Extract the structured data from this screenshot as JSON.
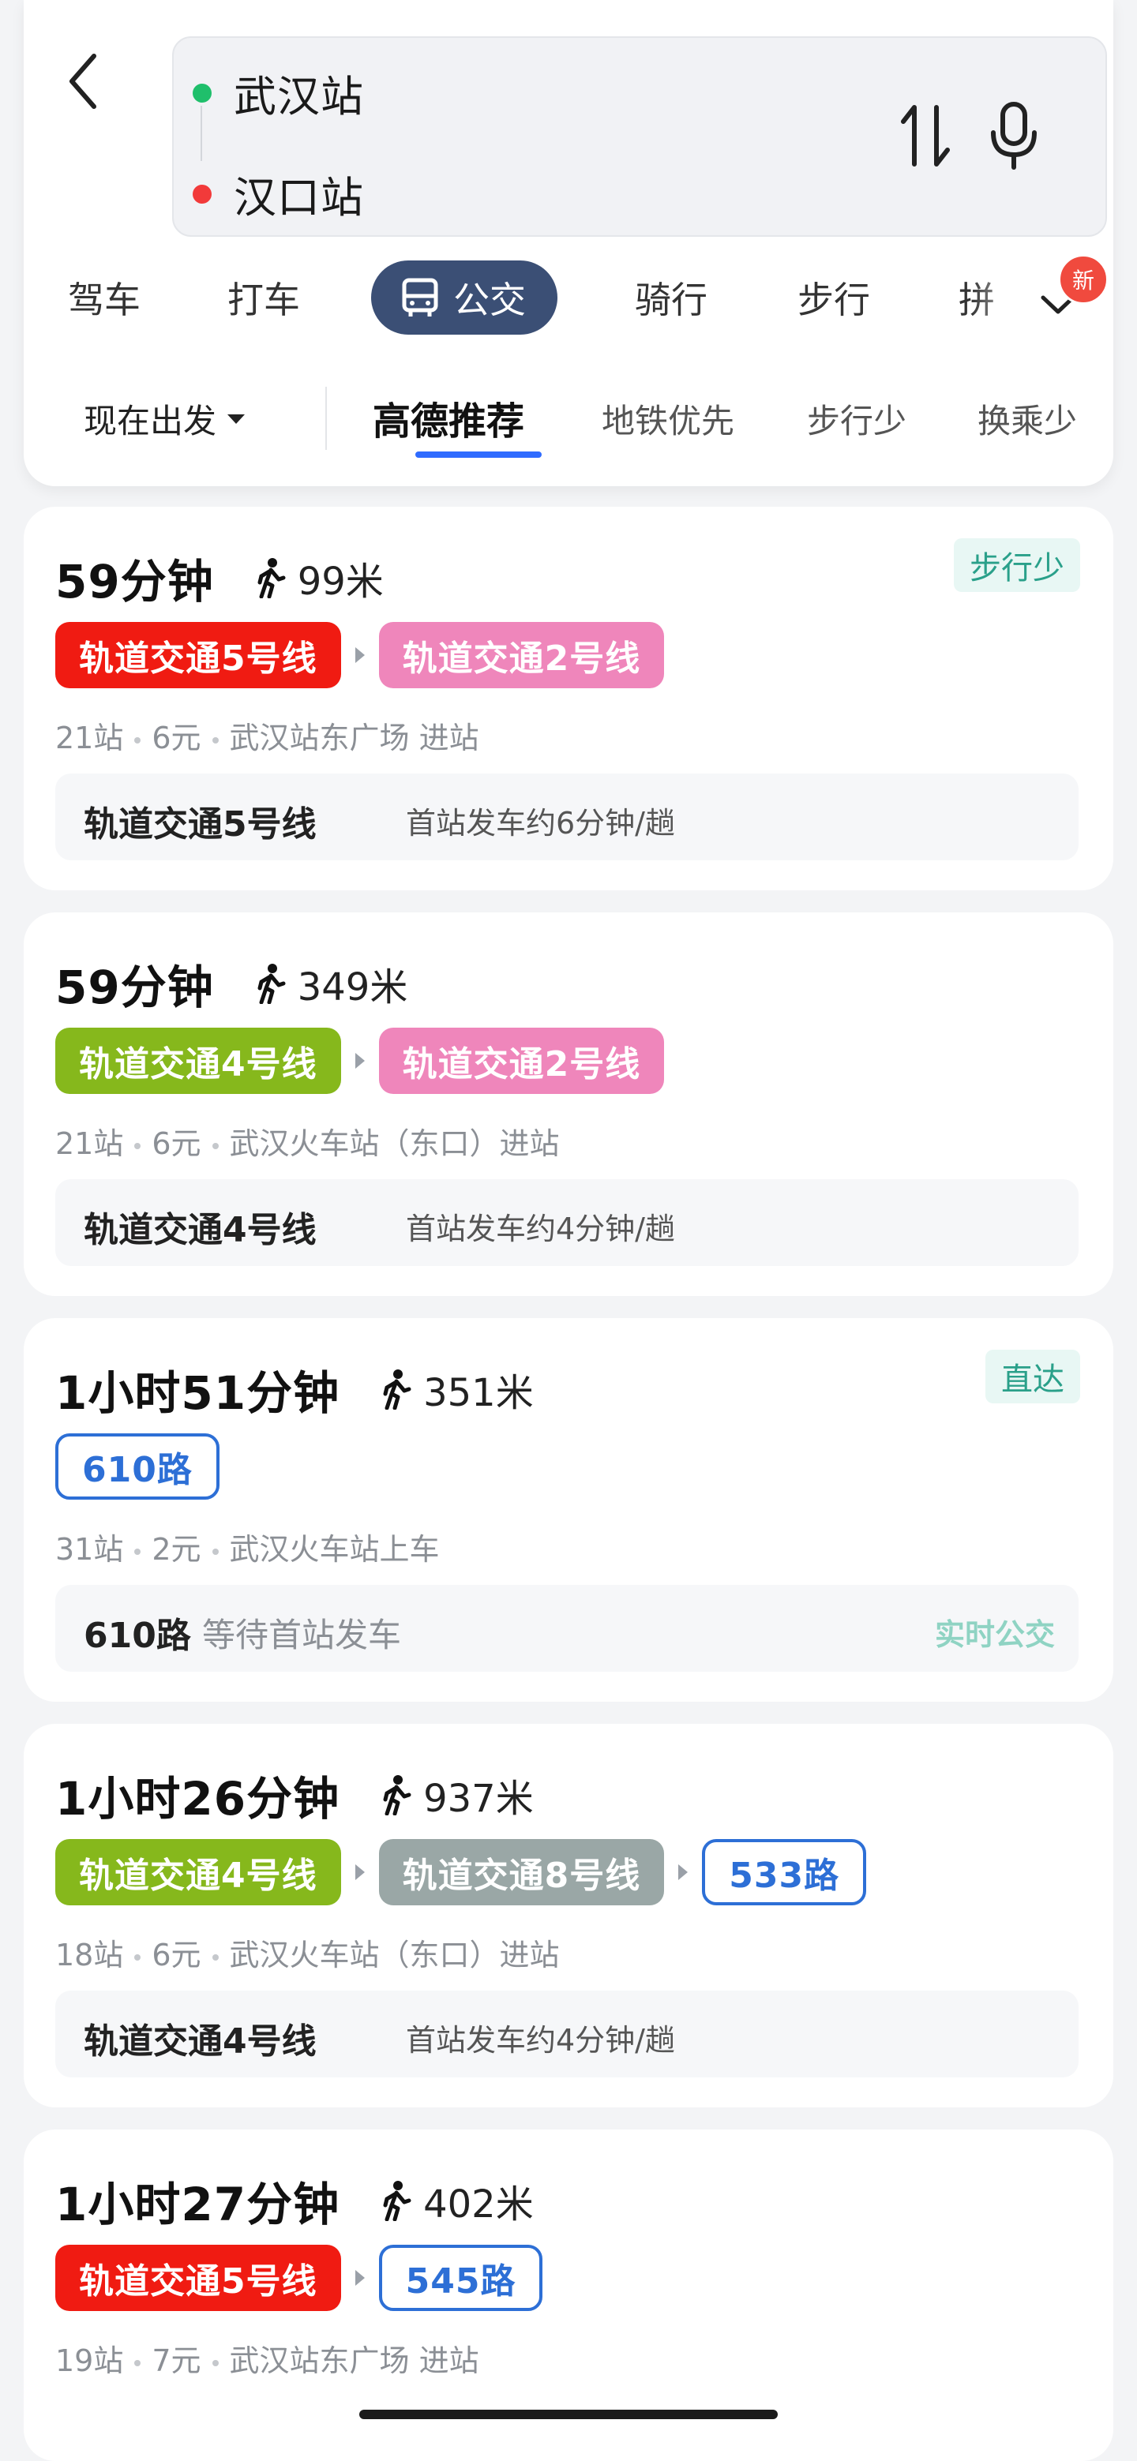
{
  "route": {
    "from": "武汉站",
    "to": "汉口站"
  },
  "modes": [
    {
      "label": "驾车"
    },
    {
      "label": "打车"
    },
    {
      "label": "公交"
    },
    {
      "label": "骑行"
    },
    {
      "label": "步行"
    },
    {
      "label": "拼"
    }
  ],
  "new_badge": "新",
  "departure": "现在出发",
  "preferences": [
    {
      "label": "高德推荐"
    },
    {
      "label": "地铁优先"
    },
    {
      "label": "步行少"
    },
    {
      "label": "换乘少"
    }
  ],
  "colors": {
    "line5": "#f01b12",
    "line2": "#ef86bb",
    "line4": "#86b81c",
    "line8": "#9aa7a6",
    "bus": "#2d6fd6",
    "active_mode": "#3b4f75",
    "accent": "#2f6bff"
  },
  "results": [
    {
      "duration": "59分钟",
      "walk": "99米",
      "tag": "步行少",
      "lines": [
        {
          "name": "轨道交通5号线",
          "kind": "metro",
          "color": "#f01b12"
        },
        {
          "name": "轨道交通2号线",
          "kind": "metro",
          "color": "#ef86bb"
        }
      ],
      "meta": [
        "21站",
        "6元",
        "武汉站东广场 进站"
      ],
      "detail_line": "轨道交通5号线",
      "detail_info": "首站发车约6分钟/趟"
    },
    {
      "duration": "59分钟",
      "walk": "349米",
      "lines": [
        {
          "name": "轨道交通4号线",
          "kind": "metro",
          "color": "#86b81c"
        },
        {
          "name": "轨道交通2号线",
          "kind": "metro",
          "color": "#ef86bb"
        }
      ],
      "meta": [
        "21站",
        "6元",
        "武汉火车站（东口）进站"
      ],
      "detail_line": "轨道交通4号线",
      "detail_info": "首站发车约4分钟/趟"
    },
    {
      "duration": "1小时51分钟",
      "walk": "351米",
      "tag": "直达",
      "lines": [
        {
          "name": "610路",
          "kind": "bus"
        }
      ],
      "meta": [
        "31站",
        "2元",
        "武汉火车站上车"
      ],
      "detail_line": "610路",
      "detail_info": "等待首站发车",
      "detail_right": "实时公交"
    },
    {
      "duration": "1小时26分钟",
      "walk": "937米",
      "lines": [
        {
          "name": "轨道交通4号线",
          "kind": "metro",
          "color": "#86b81c"
        },
        {
          "name": "轨道交通8号线",
          "kind": "metro",
          "color": "#9aa7a6"
        },
        {
          "name": "533路",
          "kind": "bus"
        }
      ],
      "meta": [
        "18站",
        "6元",
        "武汉火车站（东口）进站"
      ],
      "detail_line": "轨道交通4号线",
      "detail_info": "首站发车约4分钟/趟"
    },
    {
      "duration": "1小时27分钟",
      "walk": "402米",
      "lines": [
        {
          "name": "轨道交通5号线",
          "kind": "metro",
          "color": "#f01b12"
        },
        {
          "name": "545路",
          "kind": "bus"
        }
      ],
      "meta": [
        "19站",
        "7元",
        "武汉站东广场 进站"
      ]
    }
  ]
}
